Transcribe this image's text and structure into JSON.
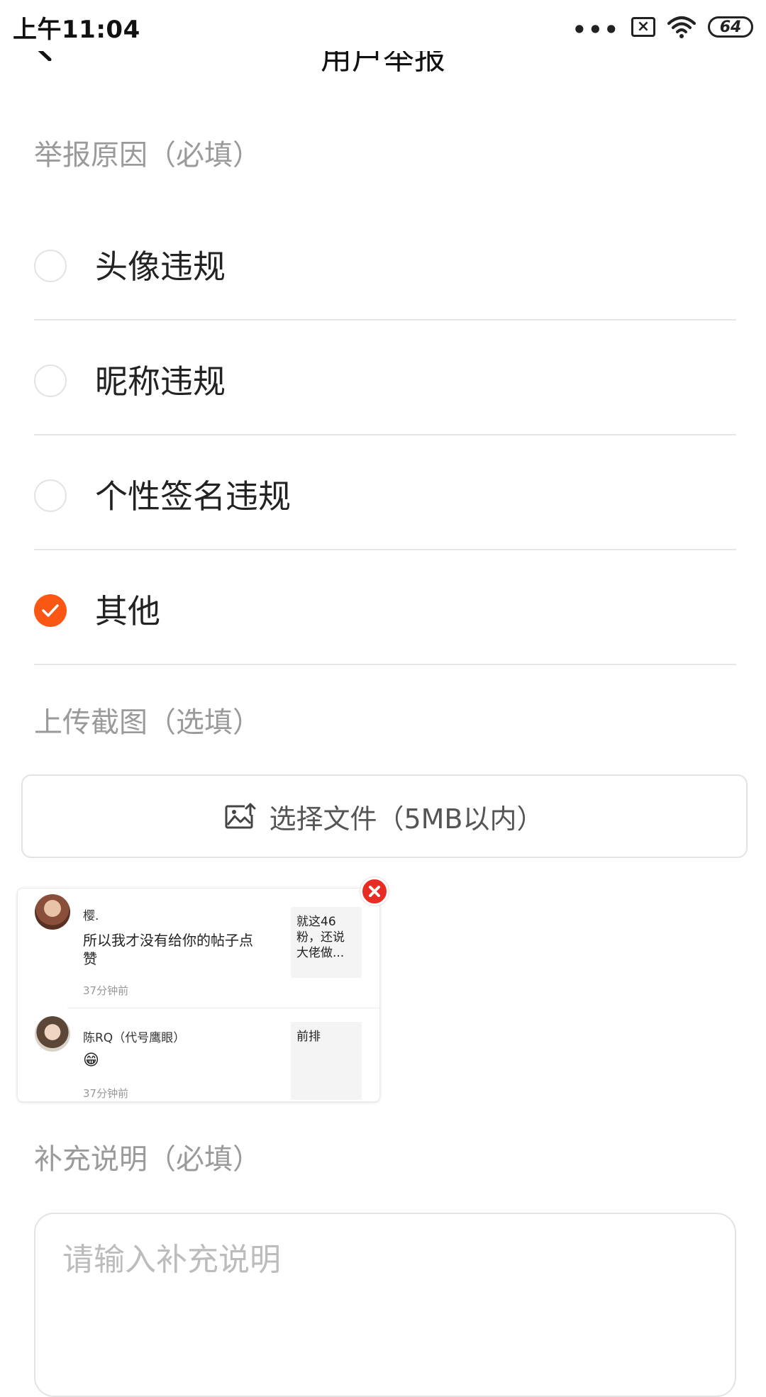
{
  "status_bar": {
    "time": "上午11:04",
    "dots": "•••",
    "sim_icon": "sim-x-icon",
    "battery_level": "64"
  },
  "header": {
    "title": "用户举报"
  },
  "reason_section": {
    "label": "举报原因（必填）",
    "options": [
      {
        "label": "头像违规",
        "checked": false
      },
      {
        "label": "昵称违规",
        "checked": false
      },
      {
        "label": "个性签名违规",
        "checked": false
      },
      {
        "label": "其他",
        "checked": true
      }
    ]
  },
  "upload_section": {
    "label": "上传截图（选填）",
    "button_label": "选择文件（5MB以内）",
    "button_icon": "image-upload-icon"
  },
  "thumbnail": {
    "comments": [
      {
        "name": "樱.",
        "text": "所以我才没有给你的帖子点赞",
        "time": "37分钟前",
        "quote": "就这46粉，还说大佬做..."
      },
      {
        "name": "陈RQ（代号鹰眼）",
        "text": "😁",
        "time": "37分钟前",
        "quote": "前排"
      }
    ]
  },
  "remark_section": {
    "label": "补充说明（必填）",
    "placeholder": "请输入补充说明"
  },
  "colors": {
    "accent": "#fa5614",
    "remove": "#e82c24",
    "label_gray": "#9a9a9a"
  }
}
